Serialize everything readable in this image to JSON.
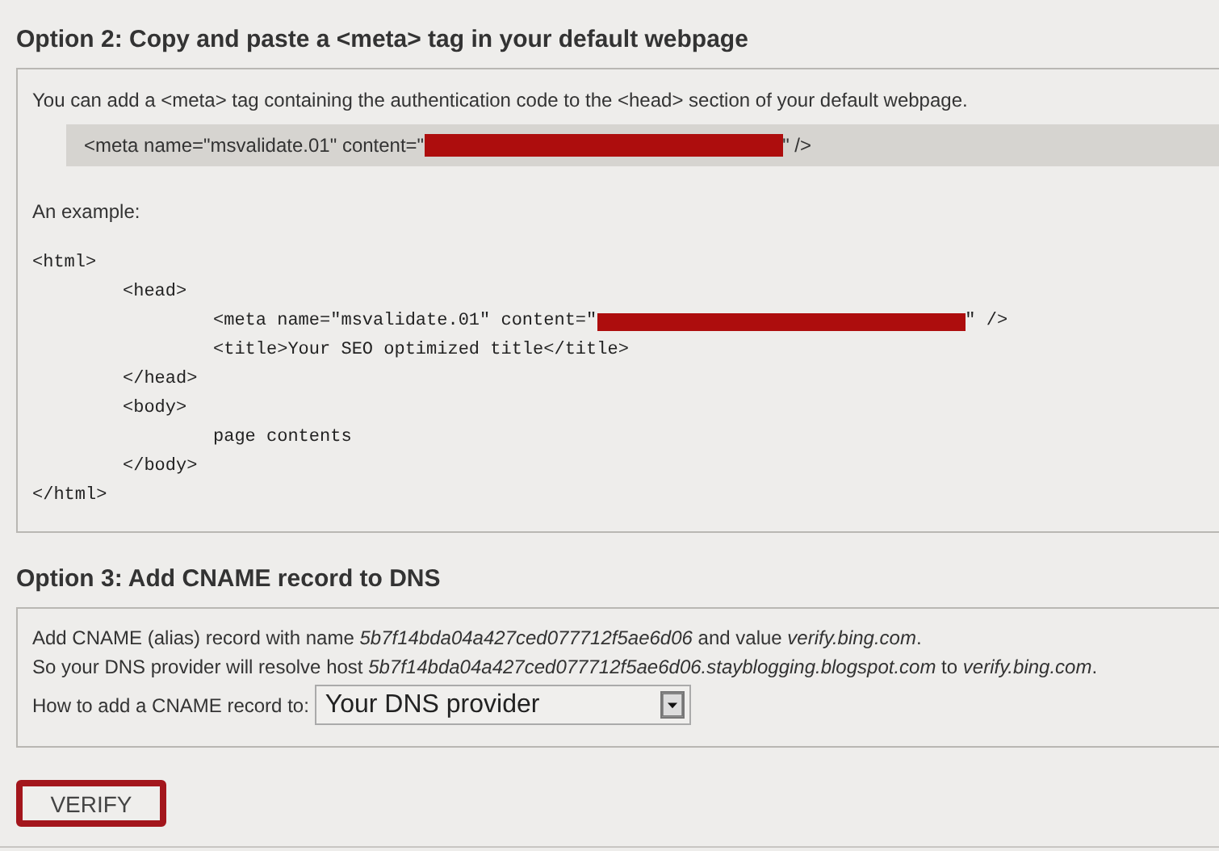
{
  "option2": {
    "heading": "Option 2: Copy and paste a <meta> tag in your default webpage",
    "intro": "You can add a <meta> tag containing the authentication code to the <head> section of your default webpage.",
    "meta_tag": {
      "before": "<meta name=\"msvalidate.01\" content=\"",
      "redacted": true,
      "after": "\" />"
    },
    "example_label": "An example:",
    "example": [
      {
        "open": "<html>",
        "close": "</html>",
        "children": [
          {
            "open": "<head>",
            "close": "</head>",
            "children": [
              {
                "before": "<meta name=\"msvalidate.01\" content=\"",
                "redacted": true,
                "after": "\" />"
              },
              {
                "before": "<title>Your SEO optimized title</title>",
                "redacted": false
              }
            ]
          },
          {
            "open": "<body>",
            "close": "</body>",
            "children": [
              {
                "before": "page contents",
                "redacted": false
              }
            ]
          }
        ]
      }
    ]
  },
  "option3": {
    "heading": "Option 3: Add CNAME record to DNS",
    "lines": [
      "Add CNAME (alias) record with name *5b7f14bda04a427ced077712f5ae6d06* and value *verify.bing.com*.",
      "So your DNS provider will resolve host *5b7f14bda04a427ced077712f5ae6d06.stayblogging.blogspot.com* to *verify.bing.com*."
    ],
    "select_label": "How to add a CNAME record to:",
    "select_value": "Your DNS provider"
  },
  "verify_button": {
    "label": "VERIFY",
    "highlighted": true
  }
}
